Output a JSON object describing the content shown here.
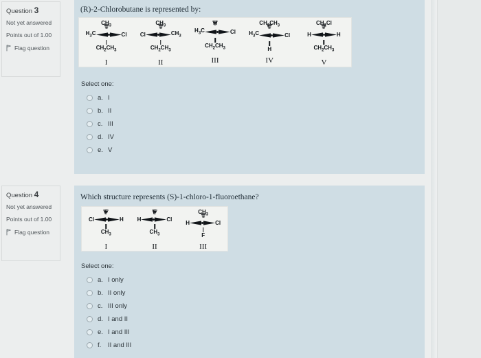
{
  "questions": [
    {
      "info": {
        "title_prefix": "Question",
        "number": "3",
        "state": "Not yet answered",
        "points": "Points out of 1.00",
        "flag_label": "Flag question",
        "flag_icon": "flag-icon"
      },
      "stem": "(R)-2-Chlorobutane is represented by:",
      "structures": [
        {
          "top": "CH3",
          "left": "H3C",
          "right": "Cl",
          "bottom": "CH2CH3",
          "roman": "I"
        },
        {
          "top": "CH3",
          "left": "Cl",
          "right": "CH3",
          "bottom": "CH2CH3",
          "roman": "II"
        },
        {
          "top": "H",
          "left": "H3C",
          "right": "Cl",
          "bottom": "CH2CH3",
          "roman": "III"
        },
        {
          "top": "CH2CH3",
          "left": "H3C",
          "right": "Cl",
          "bottom": "H",
          "roman": "IV"
        },
        {
          "top": "CH2Cl",
          "left": "H",
          "right": "H",
          "bottom": "CH2CH3",
          "roman": "V"
        }
      ],
      "select_label": "Select one:",
      "options": [
        {
          "key": "a.",
          "text": "I"
        },
        {
          "key": "b.",
          "text": "II"
        },
        {
          "key": "c.",
          "text": "III"
        },
        {
          "key": "d.",
          "text": "IV"
        },
        {
          "key": "e.",
          "text": "V"
        }
      ]
    },
    {
      "info": {
        "title_prefix": "Question",
        "number": "4",
        "state": "Not yet answered",
        "points": "Points out of 1.00",
        "flag_label": "Flag question",
        "flag_icon": "flag-icon"
      },
      "stem": "Which structure represents (S)-1-chloro-1-fluoroethane?",
      "structures": [
        {
          "top": "F",
          "left": "Cl",
          "right": "H",
          "bottom": "CH3",
          "roman": "I"
        },
        {
          "top": "F",
          "left": "H",
          "right": "Cl",
          "bottom": "CH3",
          "roman": "II"
        },
        {
          "top": "CH3",
          "left": "H",
          "right": "Cl",
          "bottom": "F",
          "roman": "III"
        }
      ],
      "select_label": "Select one:",
      "options": [
        {
          "key": "a.",
          "text": "I only"
        },
        {
          "key": "b.",
          "text": "II only"
        },
        {
          "key": "c.",
          "text": "III only"
        },
        {
          "key": "d.",
          "text": "I and II"
        },
        {
          "key": "e.",
          "text": "I and III"
        },
        {
          "key": "f.",
          "text": "II and III"
        }
      ]
    }
  ],
  "colors": {
    "panel": "#cfdde4",
    "figure_box": "#f2f3f1",
    "page": "#eceeee",
    "text": "#2b3338"
  }
}
